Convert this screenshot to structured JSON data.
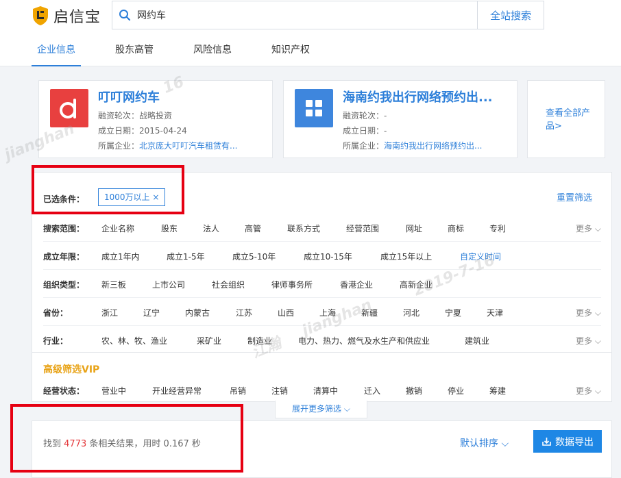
{
  "app": {
    "logo_text": "启信宝"
  },
  "search": {
    "value": "网约车",
    "button": "全站搜索"
  },
  "tabs": [
    "企业信息",
    "股东高管",
    "风险信息",
    "知识产权"
  ],
  "cards": [
    {
      "title": "叮叮网约车",
      "funding_label": "融资轮次：",
      "funding": "战略投资",
      "date_label": "成立日期：",
      "date": "2015-04-24",
      "company_label": "所属企业：",
      "company": "北京庞大叮叮汽车租赁有..."
    },
    {
      "title": "海南约我出行网络预约出...",
      "funding_label": "融资轮次：",
      "funding": "-",
      "date_label": "成立日期：",
      "date": "-",
      "company_label": "所属企业：",
      "company": "海南约我出行网络预约出..."
    }
  ],
  "more_products": "查看全部产品>",
  "filters": {
    "selected_label": "已选条件：",
    "selected_chip": "1000万以上 ×",
    "reset": "重置筛选",
    "more": "更多",
    "rows": [
      {
        "label": "搜索范围：",
        "options": [
          "企业名称",
          "股东",
          "法人",
          "高管",
          "联系方式",
          "经营范围",
          "网址",
          "商标",
          "专利"
        ]
      },
      {
        "label": "成立年限：",
        "options": [
          "成立1年内",
          "成立1-5年",
          "成立5-10年",
          "成立10-15年",
          "成立15年以上",
          "自定义时间"
        ]
      },
      {
        "label": "组织类型：",
        "options": [
          "新三板",
          "上市公司",
          "社会组织",
          "律师事务所",
          "香港企业",
          "高新企业"
        ]
      },
      {
        "label": "省份：",
        "options": [
          "浙江",
          "辽宁",
          "内蒙古",
          "江苏",
          "山西",
          "上海",
          "新疆",
          "河北",
          "宁夏",
          "天津"
        ]
      },
      {
        "label": "行业：",
        "options": [
          "农、林、牧、渔业",
          "采矿业",
          "制造业",
          "电力、热力、燃气及水生产和供应业",
          "建筑业"
        ]
      }
    ],
    "advanced_title": "高级筛选VIP",
    "status_row": {
      "label": "经营状态：",
      "options": [
        "营业中",
        "开业经营异常",
        "吊销",
        "注销",
        "清算中",
        "迁入",
        "撤销",
        "停业",
        "筹建"
      ]
    },
    "expand": "展开更多筛选"
  },
  "results": {
    "prefix": "找到",
    "count": "4773",
    "suffix": "条相关结果，用时 0.167 秒",
    "sort": "默认排序",
    "export": "数据导出"
  },
  "watermarks": [
    "16",
    "jianghan",
    "江瀚",
    "jianghan",
    "2019-7-16"
  ],
  "colors": {
    "accent": "#2d7fd9",
    "highlight": "#e60012",
    "vip": "#e8a317"
  }
}
